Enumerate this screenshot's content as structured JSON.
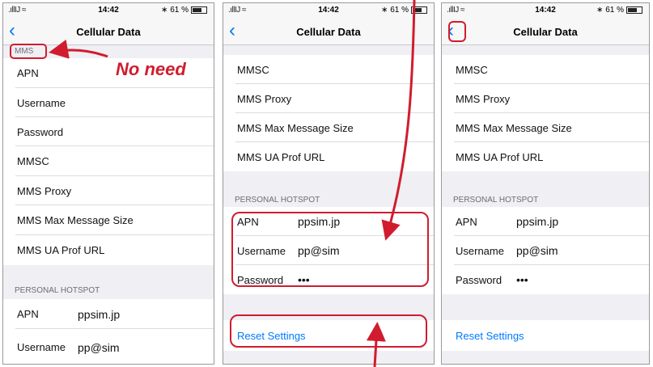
{
  "status": {
    "signal": ".ıllIJ ≈",
    "time": "14:42",
    "battery": "∗ 61 %"
  },
  "nav": {
    "back_glyph": "‹",
    "title": "Cellular Data"
  },
  "annotation": {
    "no_need": "No need"
  },
  "screen1": {
    "mms_header": "MMS",
    "rows": [
      "APN",
      "Username",
      "Password",
      "MMSC",
      "MMS Proxy",
      "MMS Max Message Size",
      "MMS UA Prof URL"
    ],
    "hotspot_header": "PERSONAL HOTSPOT",
    "hotspot_rows": [
      {
        "label": "APN",
        "value": "ppsim.jp"
      },
      {
        "label": "Username",
        "value": "pp@sim"
      }
    ]
  },
  "screen2": {
    "rows": [
      "MMSC",
      "MMS Proxy",
      "MMS Max Message Size",
      "MMS UA Prof URL"
    ],
    "hotspot_header": "PERSONAL HOTSPOT",
    "hotspot_rows": [
      {
        "label": "APN",
        "value": "ppsim.jp"
      },
      {
        "label": "Username",
        "value": "pp@sim"
      },
      {
        "label": "Password",
        "value": "•••"
      }
    ],
    "reset": "Reset Settings"
  },
  "screen3": {
    "rows": [
      "MMSC",
      "MMS Proxy",
      "MMS Max Message Size",
      "MMS UA Prof URL"
    ],
    "hotspot_header": "PERSONAL HOTSPOT",
    "hotspot_rows": [
      {
        "label": "APN",
        "value": "ppsim.jp"
      },
      {
        "label": "Username",
        "value": "pp@sim"
      },
      {
        "label": "Password",
        "value": "•••"
      }
    ],
    "reset": "Reset Settings"
  },
  "colors": {
    "accent": "#007aff",
    "highlight": "#d01c2e"
  }
}
